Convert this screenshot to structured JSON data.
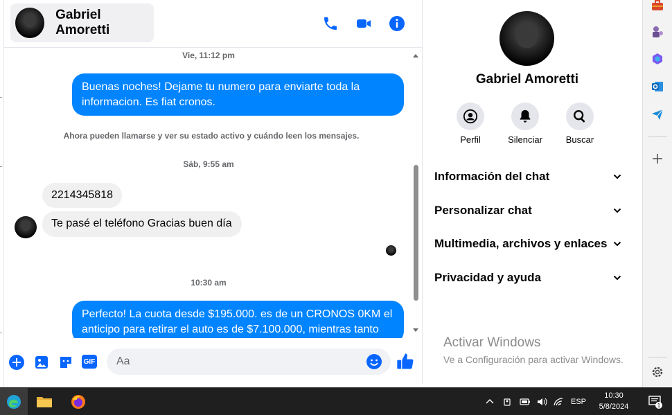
{
  "contact": {
    "name": "Gabriel Amoretti"
  },
  "header_icons": [
    "phone-icon",
    "video-icon",
    "info-icon"
  ],
  "messages": {
    "ts1": "Vie, 11:12 pm",
    "out1_line1": "Buenas noches! Dejame tu numero para enviarte toda la",
    "out1_line2": "informacion. Es fiat cronos.",
    "system": "Ahora pueden llamarse y ver su estado activo y cuándo leen los mensajes.",
    "ts2": "Sáb, 9:55 am",
    "in1": "2214345818",
    "in2": "Te pasé el teléfono Gracias buen día",
    "ts3": "10:30 am",
    "out2_line1": "Perfecto! La cuota desde $195.000. es de un CRONOS 0KM el",
    "out2_line2": "anticipo para retirar el auto es de $7.100.000, mientras tanto"
  },
  "composer": {
    "placeholder": "Aa",
    "gif_label": "GIF"
  },
  "info_panel": {
    "name": "Gabriel Amoretti",
    "actions": [
      {
        "label": "Perfil",
        "icon": "profile-icon"
      },
      {
        "label": "Silenciar",
        "icon": "bell-icon"
      },
      {
        "label": "Buscar",
        "icon": "search-icon"
      }
    ],
    "sections": [
      "Información del chat",
      "Personalizar chat",
      "Multimedia, archivos y enlaces",
      "Privacidad y ayuda"
    ]
  },
  "watermark": {
    "title": "Activar Windows",
    "subtitle": "Ve a Configuración para activar Windows."
  },
  "taskbar": {
    "language": "ESP",
    "time": "10:30",
    "date": "5/8/2024",
    "notification_count": "1"
  },
  "colors": {
    "accent": "#0866ff",
    "bubble_out": "#0084ff",
    "bubble_in": "#f0f0f0"
  }
}
